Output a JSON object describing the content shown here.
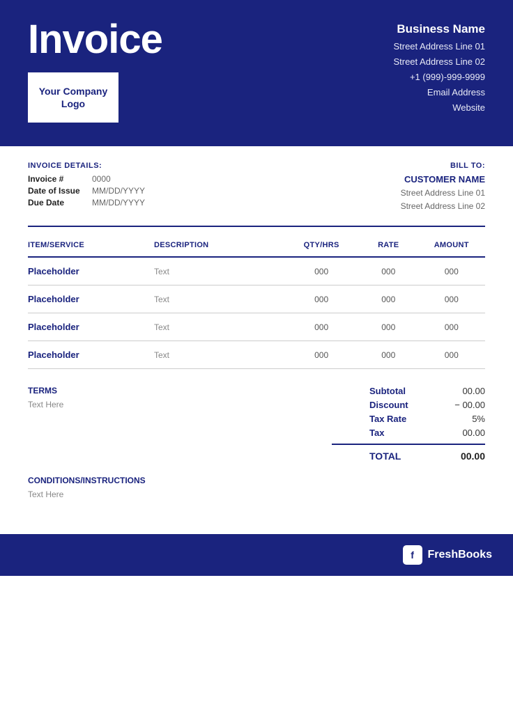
{
  "header": {
    "invoice_title": "Invoice",
    "logo_text": "Your Company Logo",
    "business_name": "Business Name",
    "address_line1": "Street Address Line 01",
    "address_line2": "Street Address Line 02",
    "phone": "+1 (999)-999-9999",
    "email": "Email Address",
    "website": "Website"
  },
  "invoice_details": {
    "section_label": "INVOICE DETAILS:",
    "invoice_label": "Invoice #",
    "invoice_value": "0000",
    "issue_label": "Date of Issue",
    "issue_value": "MM/DD/YYYY",
    "due_label": "Due Date",
    "due_value": "MM/DD/YYYY"
  },
  "bill_to": {
    "label": "BILL TO:",
    "customer_name": "CUSTOMER NAME",
    "address_line1": "Street Address Line 01",
    "address_line2": "Street Address Line 02"
  },
  "table": {
    "headers": {
      "item": "ITEM/SERVICE",
      "description": "DESCRIPTION",
      "qty": "QTY/HRS",
      "rate": "RATE",
      "amount": "AMOUNT"
    },
    "rows": [
      {
        "item": "Placeholder",
        "description": "Text",
        "qty": "000",
        "rate": "000",
        "amount": "000"
      },
      {
        "item": "Placeholder",
        "description": "Text",
        "qty": "000",
        "rate": "000",
        "amount": "000"
      },
      {
        "item": "Placeholder",
        "description": "Text",
        "qty": "000",
        "rate": "000",
        "amount": "000"
      },
      {
        "item": "Placeholder",
        "description": "Text",
        "qty": "000",
        "rate": "000",
        "amount": "000"
      }
    ]
  },
  "terms": {
    "label": "TERMS",
    "text": "Text Here"
  },
  "totals": {
    "subtotal_label": "Subtotal",
    "subtotal_value": "00.00",
    "discount_label": "Discount",
    "discount_value": "− 00.00",
    "taxrate_label": "Tax Rate",
    "taxrate_value": "5%",
    "tax_label": "Tax",
    "tax_value": "00.00",
    "total_label": "TOTAL",
    "total_value": "00.00"
  },
  "conditions": {
    "label": "CONDITIONS/INSTRUCTIONS",
    "text": "Text Here"
  },
  "footer": {
    "brand": "FreshBooks",
    "icon_letter": "f"
  }
}
